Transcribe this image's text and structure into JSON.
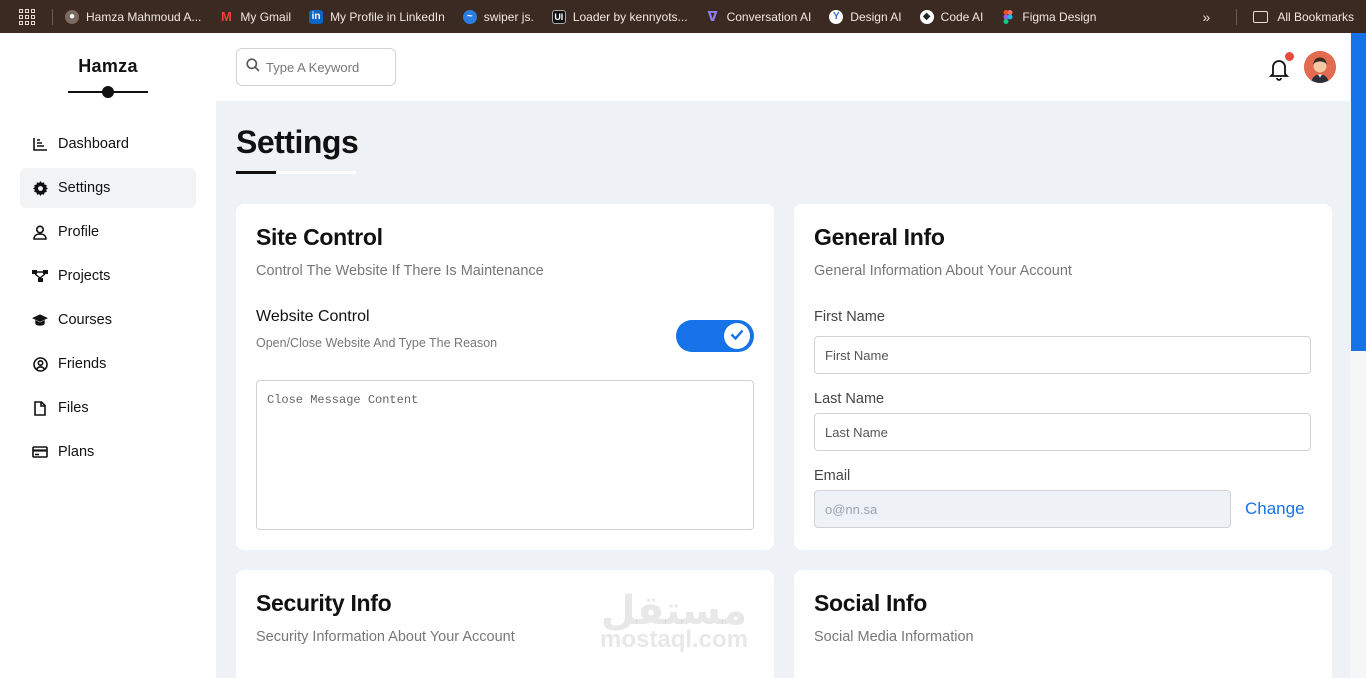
{
  "bookmarks": {
    "items": [
      {
        "label": "Hamza Mahmoud A...",
        "icon": "person-icon",
        "color": "#7a6a61"
      },
      {
        "label": "My Gmail",
        "icon": "gmail-icon",
        "color": "#d93025"
      },
      {
        "label": "My Profile in LinkedIn",
        "icon": "linkedin-icon",
        "color": "#0a66c2"
      },
      {
        "label": "swiper js.",
        "icon": "swiper-icon",
        "color": "#2a7de1"
      },
      {
        "label": "Loader by kennyots...",
        "icon": "uiverse-icon",
        "color": "#1b1b1b"
      },
      {
        "label": "Conversation AI",
        "icon": "conversation-ai-icon",
        "color": "#6b5bd6"
      },
      {
        "label": "Design AI",
        "icon": "design-ai-icon",
        "color": "#3a6fd8"
      },
      {
        "label": "Code AI",
        "icon": "code-ai-icon",
        "color": "#222222"
      },
      {
        "label": "Figma Design",
        "icon": "figma-icon",
        "color": "#f24e1e"
      }
    ],
    "more": "»",
    "all_bookmarks": "All Bookmarks"
  },
  "sidebar": {
    "brand": "Hamza",
    "items": [
      {
        "label": "Dashboard",
        "icon": "chart-icon"
      },
      {
        "label": "Settings",
        "icon": "gear-icon"
      },
      {
        "label": "Profile",
        "icon": "user-icon"
      },
      {
        "label": "Projects",
        "icon": "diagram-icon"
      },
      {
        "label": "Courses",
        "icon": "graduation-cap-icon"
      },
      {
        "label": "Friends",
        "icon": "user-circle-icon"
      },
      {
        "label": "Files",
        "icon": "file-icon"
      },
      {
        "label": "Plans",
        "icon": "credit-card-icon"
      }
    ]
  },
  "header": {
    "search_placeholder": "Type A Keyword"
  },
  "page": {
    "title": "Settings"
  },
  "site_control": {
    "title": "Site Control",
    "subtitle": "Control The Website If There Is Maintenance",
    "website_control_label": "Website Control",
    "website_control_sub": "Open/Close Website And Type The Reason",
    "toggle_on": true,
    "message_placeholder": "Close Message Content"
  },
  "general_info": {
    "title": "General Info",
    "subtitle": "General Information About Your Account",
    "first_name_label": "First Name",
    "first_name_placeholder": "First Name",
    "last_name_label": "Last Name",
    "last_name_placeholder": "Last Name",
    "email_label": "Email",
    "email_value": "o@nn.sa",
    "change_label": "Change"
  },
  "security_info": {
    "title": "Security Info",
    "subtitle": "Security Information About Your Account"
  },
  "social_info": {
    "title": "Social Info",
    "subtitle": "Social Media Information"
  },
  "watermark": {
    "arabic": "مستقل",
    "latin": "mostaql.com"
  },
  "colors": {
    "accent": "#1672e8",
    "notification": "#e84a3c",
    "bookmarks_bg": "#3b2a22"
  }
}
